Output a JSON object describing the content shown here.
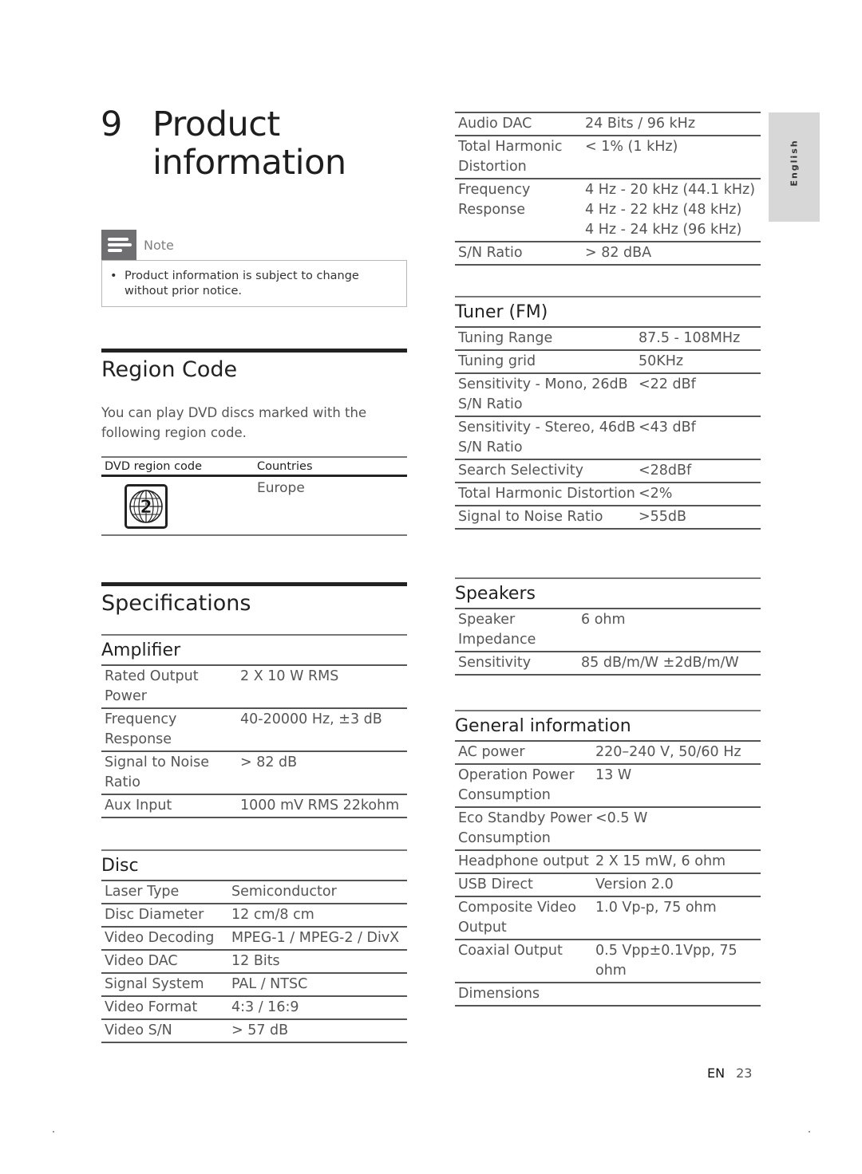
{
  "chapter": {
    "number": "9",
    "title": "Product information"
  },
  "note": {
    "label": "Note",
    "icon": "note-lines-icon",
    "bullet": "•",
    "text": "Product information is subject to change without prior notice."
  },
  "region_code": {
    "title": "Region Code",
    "description": "You can play DVD discs marked with the following region code.",
    "table": {
      "headers": [
        "DVD region code",
        "Countries"
      ],
      "rows": [
        {
          "icon": "dvd-region-2-globe-icon",
          "region_number": "2",
          "countries": "Europe"
        }
      ]
    }
  },
  "specifications": {
    "title": "Specifications",
    "amplifier": {
      "title": "Amplifier",
      "rows": [
        {
          "k": "Rated Output Power",
          "v": "2 X 10 W RMS"
        },
        {
          "k": "Frequency Response",
          "v": "40-20000 Hz, ±3 dB"
        },
        {
          "k": "Signal to Noise Ratio",
          "v": "> 82 dB"
        },
        {
          "k": "Aux Input",
          "v": "1000 mV RMS 22kohm"
        }
      ]
    },
    "disc": {
      "title": "Disc",
      "rows": [
        {
          "k": "Laser Type",
          "v": "Semiconductor"
        },
        {
          "k": "Disc Diameter",
          "v": "12 cm/8 cm"
        },
        {
          "k": "Video Decoding",
          "v": "MPEG-1 / MPEG-2 / DivX"
        },
        {
          "k": "Video DAC",
          "v": "12 Bits"
        },
        {
          "k": "Signal System",
          "v": "PAL / NTSC"
        },
        {
          "k": "Video Format",
          "v": "4:3 / 16:9"
        },
        {
          "k": "Video S/N",
          "v": "> 57 dB"
        }
      ]
    },
    "disc_audio": {
      "rows": [
        {
          "k": "Audio DAC",
          "v": "24 Bits / 96 kHz"
        },
        {
          "k": "Total Harmonic Distortion",
          "v": "< 1% (1 kHz)"
        },
        {
          "k": "Frequency Response",
          "v": "4 Hz - 20 kHz (44.1 kHz)\n4 Hz - 22 kHz (48 kHz)\n4 Hz - 24 kHz (96 kHz)"
        },
        {
          "k": "S/N Ratio",
          "v": "> 82 dBA"
        }
      ]
    },
    "tuner": {
      "title": "Tuner (FM)",
      "rows": [
        {
          "k": "Tuning Range",
          "v": "87.5 - 108MHz"
        },
        {
          "k": "Tuning grid",
          "v": "50KHz"
        },
        {
          "k": "Sensitivity - Mono, 26dB S/N Ratio",
          "v": "<22 dBf"
        },
        {
          "k": "Sensitivity - Stereo, 46dB S/N Ratio",
          "v": "<43 dBf"
        },
        {
          "k": "Search Selectivity",
          "v": "<28dBf"
        },
        {
          "k": "Total Harmonic Distortion",
          "v": "<2%"
        },
        {
          "k": "Signal to Noise Ratio",
          "v": ">55dB"
        }
      ]
    },
    "speakers": {
      "title": "Speakers",
      "rows": [
        {
          "k": "Speaker Impedance",
          "v": "6 ohm"
        },
        {
          "k": "Sensitivity",
          "v": "85 dB/m/W ±2dB/m/W"
        }
      ]
    },
    "general": {
      "title": "General information",
      "rows": [
        {
          "k": "AC power",
          "v": "220–240 V, 50/60 Hz"
        },
        {
          "k": "Operation Power Consumption",
          "v": "13 W"
        },
        {
          "k": "Eco Standby Power Consumption",
          "v": "<0.5 W"
        },
        {
          "k": "Headphone output",
          "v": "2 X 15 mW, 6 ohm"
        },
        {
          "k": "USB Direct",
          "v": "Version 2.0"
        },
        {
          "k": "Composite Video Output",
          "v": "1.0 Vp-p, 75 ohm"
        },
        {
          "k": "Coaxial Output",
          "v": "0.5 Vpp±0.1Vpp, 75 ohm"
        },
        {
          "k": "Dimensions",
          "v": ""
        }
      ]
    }
  },
  "language_tab": "English",
  "footer": {
    "lang": "EN",
    "page": "23"
  }
}
